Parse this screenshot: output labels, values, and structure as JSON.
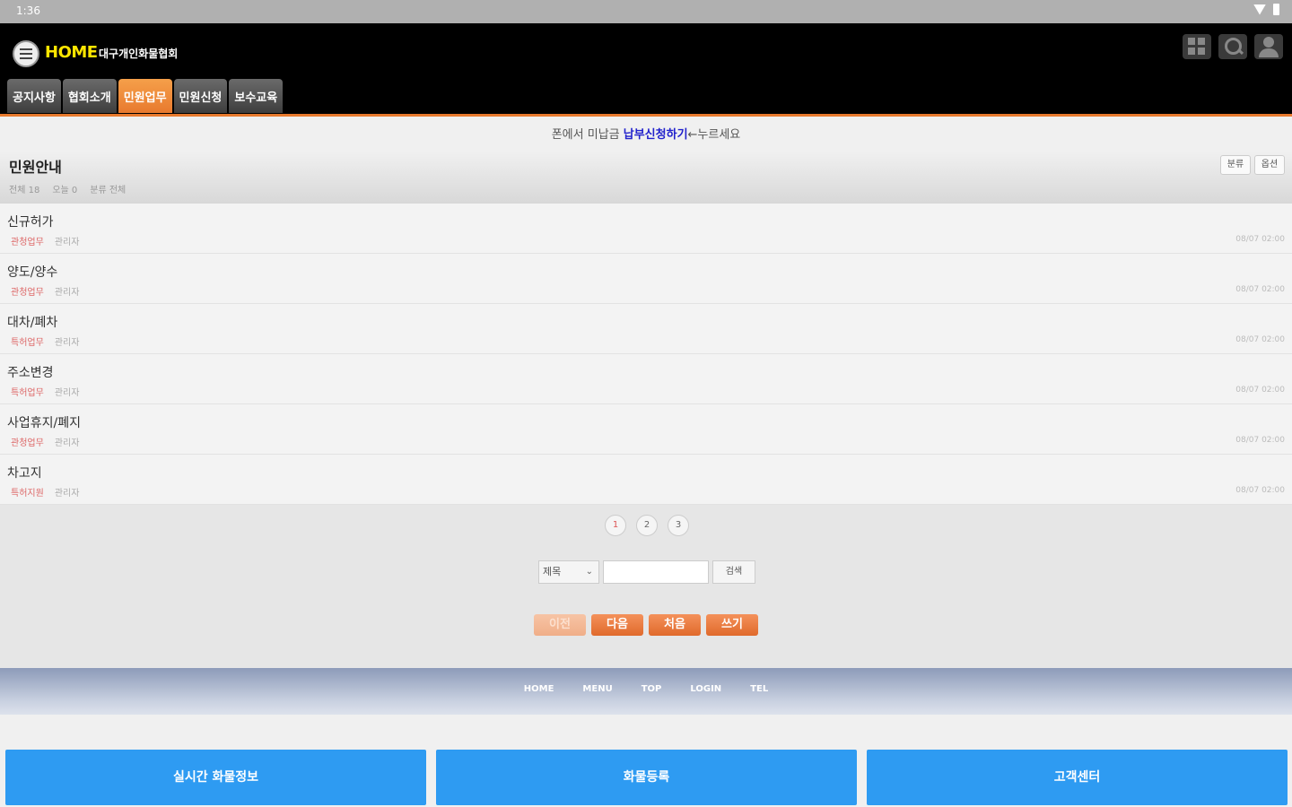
{
  "status_bar": {
    "time": "1:36"
  },
  "header": {
    "home_label": "HOME",
    "org_label": "대구개인화물협회",
    "tabs": [
      {
        "label": "공지사항",
        "active": false
      },
      {
        "label": "협회소개",
        "active": false
      },
      {
        "label": "민원업무",
        "active": true
      },
      {
        "label": "민원신청",
        "active": false
      },
      {
        "label": "보수교육",
        "active": false
      }
    ]
  },
  "notice": {
    "prefix": "폰에서 미납금",
    "link": "납부신청하기",
    "suffix": "←누르세요"
  },
  "board": {
    "title": "민원안내",
    "meta": [
      "전체 18",
      "오늘 0",
      "분류 전체"
    ],
    "buttons": [
      "분류",
      "옵션"
    ]
  },
  "items": [
    {
      "title": "신규허가",
      "category": "관청업무",
      "author": "관리자",
      "date": "08/07 02:00"
    },
    {
      "title": "양도/양수",
      "category": "관청업무",
      "author": "관리자",
      "date": "08/07 02:00"
    },
    {
      "title": "대차/폐차",
      "category": "특허업무",
      "author": "관리자",
      "date": "08/07 02:00"
    },
    {
      "title": "주소변경",
      "category": "특허업무",
      "author": "관리자",
      "date": "08/07 02:00"
    },
    {
      "title": "사업휴지/폐지",
      "category": "관청업무",
      "author": "관리자",
      "date": "08/07 02:00"
    },
    {
      "title": "차고지",
      "category": "특허지원",
      "author": "관리자",
      "date": "08/07 02:00"
    }
  ],
  "paging": {
    "pages": [
      "1",
      "2",
      "3"
    ],
    "current": "1"
  },
  "search": {
    "field": "제목",
    "value": "",
    "button": "검색"
  },
  "nav_buttons": [
    {
      "label": "이전",
      "disabled": true
    },
    {
      "label": "다음",
      "disabled": false
    },
    {
      "label": "처음",
      "disabled": false
    },
    {
      "label": "쓰기",
      "disabled": false
    }
  ],
  "footer_links": [
    "HOME",
    "MENU",
    "TOP",
    "LOGIN",
    "TEL"
  ],
  "bottom_buttons": [
    "실시간 화물정보",
    "화물등록",
    "고객센터"
  ],
  "colors": {
    "accent_orange": "#e87a2e",
    "home_yellow": "#ffe600",
    "bottom_blue": "#2e9bf2",
    "category_red": "#dd6666"
  }
}
